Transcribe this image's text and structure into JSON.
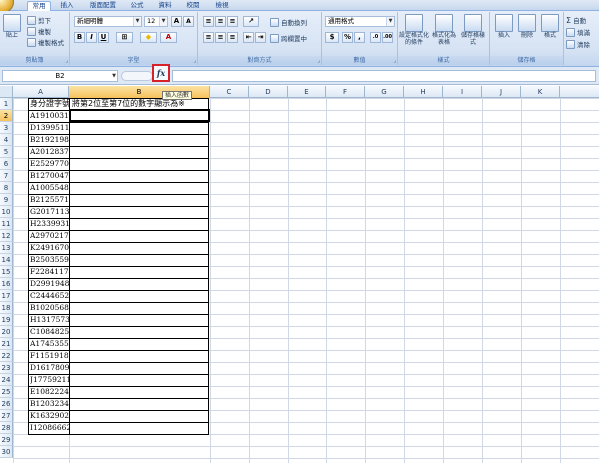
{
  "tabs": [
    "常用",
    "插入",
    "版面配置",
    "公式",
    "資料",
    "校閱",
    "檢視"
  ],
  "ribbon": {
    "clipboard": {
      "paste": "貼上",
      "cut": "剪下",
      "copy": "複製",
      "format_painter": "複製格式",
      "label": "剪貼簿"
    },
    "font": {
      "name": "新細明體",
      "size": "12",
      "bold": "B",
      "italic": "I",
      "underline": "U",
      "grow": "A",
      "shrink": "A",
      "font_color": "A",
      "label": "字型"
    },
    "alignment": {
      "wrap": "自動換列",
      "merge": "跨欄置中",
      "label": "對齊方式"
    },
    "number": {
      "format": "通用格式",
      "currency": "$",
      "percent": "%",
      "comma": ",",
      "label": "數值"
    },
    "styles": {
      "conditional": "設定格式化的條件",
      "format_table": "格式化為表格",
      "cell_styles": "儲存格樣式",
      "label": "樣式"
    },
    "cells": {
      "insert": "插入",
      "delete": "刪除",
      "format": "格式",
      "label": "儲存格"
    },
    "editing": {
      "autosum": "自動",
      "fill": "填滿",
      "clear": "清除"
    }
  },
  "formula_bar": {
    "name_box": "B2",
    "fx": "fx",
    "tooltip": "插入函數",
    "formula": ""
  },
  "sheet": {
    "columns": [
      "A",
      "B",
      "C",
      "D",
      "E",
      "F",
      "G",
      "H",
      "I",
      "J",
      "K"
    ],
    "rows": [
      "1",
      "2",
      "3",
      "4",
      "5",
      "6",
      "7",
      "8",
      "9",
      "10",
      "11",
      "12",
      "13",
      "14",
      "15",
      "16",
      "17",
      "18",
      "19",
      "20",
      "21",
      "22",
      "23",
      "24",
      "25",
      "26",
      "27",
      "28",
      "29",
      "30"
    ],
    "header_a": "身分證字號",
    "header_b": "將第2位至第7位的數字顯示為※",
    "ids": [
      "A191003147",
      "D139951190",
      "B219219806",
      "A201283702",
      "E252977060",
      "B127004700",
      "A100554844",
      "B212557152",
      "G201711387",
      "H233993136",
      "A297021794",
      "K249167064",
      "B250355901",
      "F228411748",
      "D299194846",
      "C244465273",
      "B102056842",
      "H131757345",
      "C108482516",
      "A174535533",
      "F115191827",
      "D161780965",
      "J177592118",
      "E108222450",
      "B120323453",
      "K163290291",
      "I120866623"
    ]
  }
}
